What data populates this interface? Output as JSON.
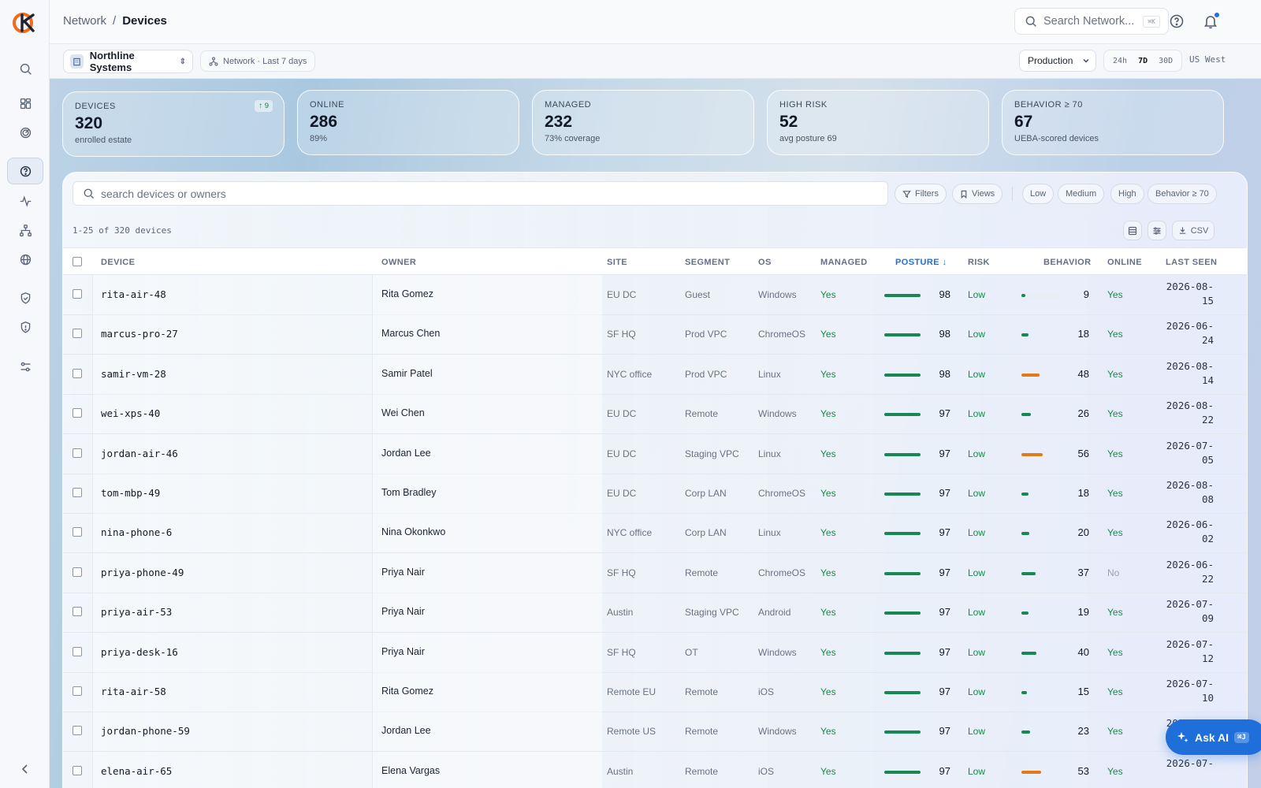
{
  "breadcrumb": {
    "parent": "Network",
    "separator": "/",
    "current": "Devices"
  },
  "topbar": {
    "search_placeholder": "Search Network...",
    "search_kbd": "⌘K"
  },
  "subbar": {
    "org": "Northline Systems",
    "scope": "Network · Last 7 days",
    "environment": "Production",
    "ranges": [
      "24h",
      "7D",
      "30D"
    ],
    "active_range": "7D",
    "region": "US West"
  },
  "kpis": [
    {
      "label": "DEVICES",
      "value": "320",
      "sub": "enrolled estate",
      "badge": "↑ 9"
    },
    {
      "label": "ONLINE",
      "value": "286",
      "sub": "89%"
    },
    {
      "label": "MANAGED",
      "value": "232",
      "sub": "73% coverage"
    },
    {
      "label": "HIGH RISK",
      "value": "52",
      "sub": "avg posture 69"
    },
    {
      "label": "BEHAVIOR ≥ 70",
      "value": "67",
      "sub": "UEBA-scored devices"
    }
  ],
  "table": {
    "search_placeholder": "search devices or owners",
    "filters_label": "Filters",
    "views_label": "Views",
    "risk_chips": [
      "Low",
      "Medium",
      "High",
      "Behavior ≥ 70"
    ],
    "count_text": "1-25 of 320 devices",
    "csv_label": "CSV",
    "columns": [
      "DEVICE",
      "OWNER",
      "SITE",
      "SEGMENT",
      "OS",
      "MANAGED",
      "POSTURE",
      "RISK",
      "BEHAVIOR",
      "ONLINE",
      "LAST SEEN"
    ],
    "sort_indicator": "↓",
    "behavior_color_low": "#198754",
    "behavior_color_mid": "#e07b1a",
    "rows": [
      {
        "device": "rita-air-48",
        "owner": "Rita Gomez",
        "site": "EU DC",
        "segment": "Guest",
        "os": "Windows",
        "managed": "Yes",
        "posture": 98,
        "risk": "Low",
        "behavior": 9,
        "online": "Yes",
        "last_seen_date": "2026-08-",
        "last_seen_day": "15"
      },
      {
        "device": "marcus-pro-27",
        "owner": "Marcus Chen",
        "site": "SF HQ",
        "segment": "Prod VPC",
        "os": "ChromeOS",
        "managed": "Yes",
        "posture": 98,
        "risk": "Low",
        "behavior": 18,
        "online": "Yes",
        "last_seen_date": "2026-06-",
        "last_seen_day": "24"
      },
      {
        "device": "samir-vm-28",
        "owner": "Samir Patel",
        "site": "NYC office",
        "segment": "Prod VPC",
        "os": "Linux",
        "managed": "Yes",
        "posture": 98,
        "risk": "Low",
        "behavior": 48,
        "online": "Yes",
        "last_seen_date": "2026-08-",
        "last_seen_day": "14"
      },
      {
        "device": "wei-xps-40",
        "owner": "Wei Chen",
        "site": "EU DC",
        "segment": "Remote",
        "os": "Windows",
        "managed": "Yes",
        "posture": 97,
        "risk": "Low",
        "behavior": 26,
        "online": "Yes",
        "last_seen_date": "2026-08-",
        "last_seen_day": "22"
      },
      {
        "device": "jordan-air-46",
        "owner": "Jordan Lee",
        "site": "EU DC",
        "segment": "Staging VPC",
        "os": "Linux",
        "managed": "Yes",
        "posture": 97,
        "risk": "Low",
        "behavior": 56,
        "online": "Yes",
        "last_seen_date": "2026-07-",
        "last_seen_day": "05"
      },
      {
        "device": "tom-mbp-49",
        "owner": "Tom Bradley",
        "site": "EU DC",
        "segment": "Corp LAN",
        "os": "ChromeOS",
        "managed": "Yes",
        "posture": 97,
        "risk": "Low",
        "behavior": 18,
        "online": "Yes",
        "last_seen_date": "2026-08-",
        "last_seen_day": "08"
      },
      {
        "device": "nina-phone-6",
        "owner": "Nina Okonkwo",
        "site": "NYC office",
        "segment": "Corp LAN",
        "os": "Linux",
        "managed": "Yes",
        "posture": 97,
        "risk": "Low",
        "behavior": 20,
        "online": "Yes",
        "last_seen_date": "2026-06-",
        "last_seen_day": "02"
      },
      {
        "device": "priya-phone-49",
        "owner": "Priya Nair",
        "site": "SF HQ",
        "segment": "Remote",
        "os": "ChromeOS",
        "managed": "Yes",
        "posture": 97,
        "risk": "Low",
        "behavior": 37,
        "online": "No",
        "last_seen_date": "2026-06-",
        "last_seen_day": "22"
      },
      {
        "device": "priya-air-53",
        "owner": "Priya Nair",
        "site": "Austin",
        "segment": "Staging VPC",
        "os": "Android",
        "managed": "Yes",
        "posture": 97,
        "risk": "Low",
        "behavior": 19,
        "online": "Yes",
        "last_seen_date": "2026-07-",
        "last_seen_day": "09"
      },
      {
        "device": "priya-desk-16",
        "owner": "Priya Nair",
        "site": "SF HQ",
        "segment": "OT",
        "os": "Windows",
        "managed": "Yes",
        "posture": 97,
        "risk": "Low",
        "behavior": 40,
        "online": "Yes",
        "last_seen_date": "2026-07-",
        "last_seen_day": "12"
      },
      {
        "device": "rita-air-58",
        "owner": "Rita Gomez",
        "site": "Remote EU",
        "segment": "Remote",
        "os": "iOS",
        "managed": "Yes",
        "posture": 97,
        "risk": "Low",
        "behavior": 15,
        "online": "Yes",
        "last_seen_date": "2026-07-",
        "last_seen_day": "10"
      },
      {
        "device": "jordan-phone-59",
        "owner": "Jordan Lee",
        "site": "Remote US",
        "segment": "Remote",
        "os": "Windows",
        "managed": "Yes",
        "posture": 97,
        "risk": "Low",
        "behavior": 23,
        "online": "Yes",
        "last_seen_date": "2026-07-",
        "last_seen_day": ""
      },
      {
        "device": "elena-air-65",
        "owner": "Elena Vargas",
        "site": "Austin",
        "segment": "Remote",
        "os": "iOS",
        "managed": "Yes",
        "posture": 97,
        "risk": "Low",
        "behavior": 53,
        "online": "Yes",
        "last_seen_date": "2026-07-",
        "last_seen_day": ""
      }
    ]
  },
  "ask_ai": {
    "label": "Ask AI",
    "kbd": "⌘J"
  }
}
